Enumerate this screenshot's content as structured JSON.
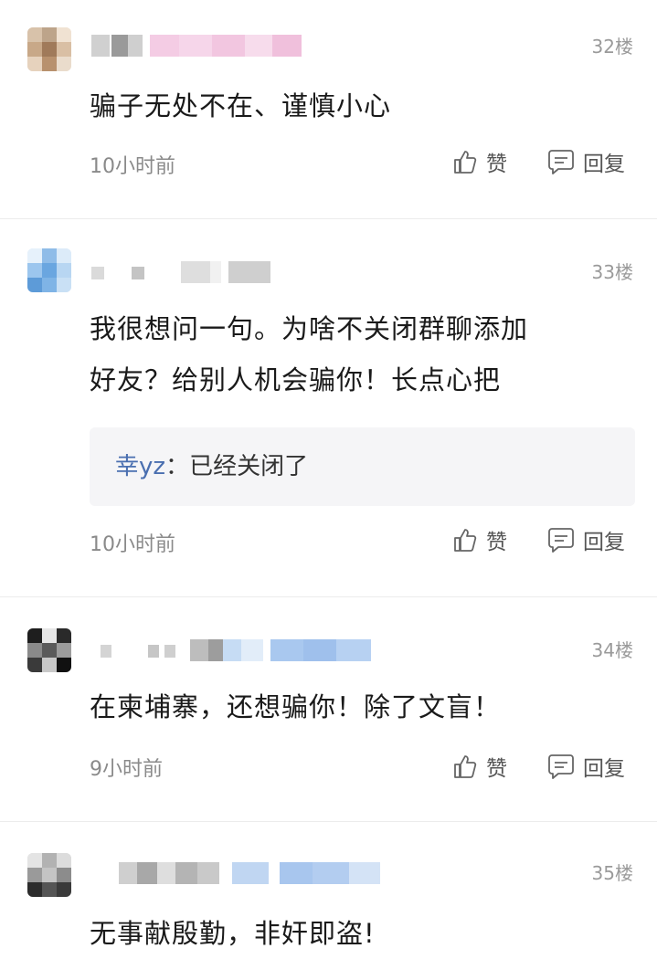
{
  "comments": [
    {
      "floor": "32楼",
      "lines": [
        "骗子无处不在、谨慎小心"
      ],
      "time": "10小时前",
      "like_label": "赞",
      "reply_label": "回复"
    },
    {
      "floor": "33楼",
      "lines": [
        "我很想问一句。为啥不关闭群聊添加",
        "好友？给别人机会骗你！长点心把"
      ],
      "reply": {
        "name": "幸yz",
        "sep": "：",
        "text": "已经关闭了"
      },
      "time": "10小时前",
      "like_label": "赞",
      "reply_label": "回复"
    },
    {
      "floor": "34楼",
      "lines": [
        "在柬埔寨，还想骗你！除了文盲！"
      ],
      "time": "9小时前",
      "like_label": "赞",
      "reply_label": "回复"
    },
    {
      "floor": "35楼",
      "lines": [
        "无事献殷勤，非奸即盗!"
      ]
    }
  ],
  "colors": {
    "floor": "#9a9a9a",
    "time": "#8a8a8a",
    "reply_name": "#4a6fb0",
    "reply_bg": "#f5f5f7"
  },
  "icons": [
    "thumbs-up-icon",
    "comment-reply-icon"
  ]
}
